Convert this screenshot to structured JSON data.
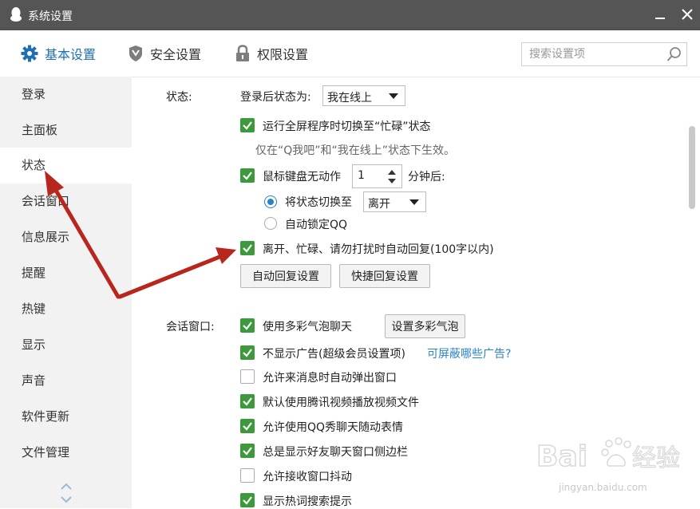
{
  "window": {
    "title": "系统设置"
  },
  "tabs": [
    {
      "label": "基本设置",
      "icon": "gear-icon",
      "active": true
    },
    {
      "label": "安全设置",
      "icon": "shield-icon",
      "active": false
    },
    {
      "label": "权限设置",
      "icon": "lock-icon",
      "active": false
    }
  ],
  "search": {
    "placeholder": "搜索设置项",
    "value": ""
  },
  "sidebar": {
    "items": [
      {
        "label": "登录"
      },
      {
        "label": "主面板"
      },
      {
        "label": "状态",
        "active": true
      },
      {
        "label": "会话窗口"
      },
      {
        "label": "信息展示"
      },
      {
        "label": "提醒"
      },
      {
        "label": "热键"
      },
      {
        "label": "显示"
      },
      {
        "label": "声音"
      },
      {
        "label": "软件更新"
      },
      {
        "label": "文件管理"
      }
    ]
  },
  "status_section": {
    "label": "状态:",
    "login_status_label": "登录后状态为:",
    "login_status_value": "我在线上",
    "fullscreen_busy": {
      "label": "运行全屏程序时切换至“忙碌”状态",
      "checked": true
    },
    "fullscreen_hint": "仅在“Q我吧”和“我在线上”状态下生效。",
    "idle": {
      "label": "鼠标键盘无动作",
      "checked": true,
      "minutes": "1",
      "suffix": "分钟后:"
    },
    "switch_status": {
      "label": "将状态切换至",
      "selected": true,
      "value": "离开"
    },
    "auto_lock": {
      "label": "自动锁定QQ",
      "selected": false
    },
    "auto_reply": {
      "label": "离开、忙碌、请勿打扰时自动回复(100字以内)",
      "checked": true
    },
    "auto_reply_button": "自动回复设置",
    "quick_reply_button": "快捷回复设置"
  },
  "chat_section": {
    "label": "会话窗口:",
    "bubble": {
      "label": "使用多彩气泡聊天",
      "checked": true,
      "button": "设置多彩气泡"
    },
    "no_ads": {
      "label": "不显示广告(超级会员设置项)",
      "checked": true,
      "link": "可屏蔽哪些广告?"
    },
    "popup": {
      "label": "允许来消息时自动弹出窗口",
      "checked": false
    },
    "video": {
      "label": "默认使用腾讯视频播放视频文件",
      "checked": true
    },
    "qqshow": {
      "label": "允许使用QQ秀聊天随动表情",
      "checked": true
    },
    "friend_sidebar": {
      "label": "总是显示好友聊天窗口侧边栏",
      "checked": true
    },
    "shake": {
      "label": "允许接收窗口抖动",
      "checked": false
    },
    "hot_search": {
      "label": "显示热词搜索提示",
      "checked": true
    }
  },
  "watermark": {
    "brand": "Bai",
    "brand2": "经验",
    "url": "jingyan.baidu.com"
  },
  "colors": {
    "accent": "#1f6fb5",
    "check": "#3c9a3c",
    "link": "#2a83c9",
    "arrow": "#b8261e",
    "titlebar": "#555555"
  }
}
